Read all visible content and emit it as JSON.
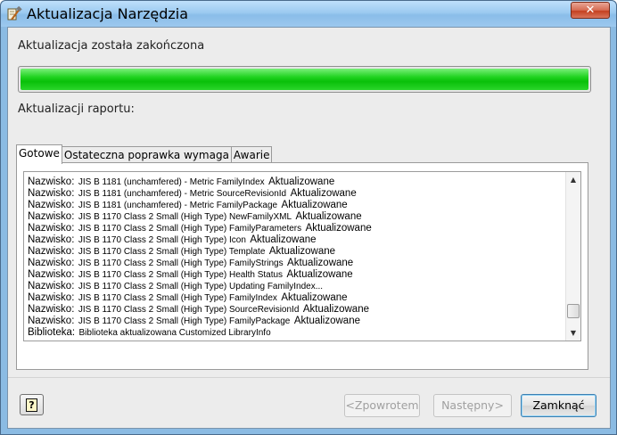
{
  "window": {
    "title": "Aktualizacja Narzędzia",
    "close_glyph": "✕",
    "app_icon": "tool-hammer-icon"
  },
  "status": {
    "message": "Aktualizacja została zakończona",
    "progress_percent": 100,
    "progress_color": "#0cc40c"
  },
  "report": {
    "label": "Aktualizacji raportu:"
  },
  "tabs": [
    {
      "label": "Gotowe",
      "active": true
    },
    {
      "label": "Ostateczna poprawka wymaga",
      "active": false
    },
    {
      "label": "Awarie",
      "active": false
    }
  ],
  "log_rows": [
    {
      "key": "Nazwisko:",
      "value": "JIS B 1181 (unchamfered) - Metric FamilyIndex",
      "status": "Aktualizowane"
    },
    {
      "key": "Nazwisko:",
      "value": "JIS B 1181 (unchamfered) - Metric SourceRevisionId",
      "status": "Aktualizowane"
    },
    {
      "key": "Nazwisko:",
      "value": "JIS B 1181 (unchamfered) - Metric FamilyPackage",
      "status": "Aktualizowane"
    },
    {
      "key": "Nazwisko:",
      "value": "JIS B 1170 Class 2 Small (High Type) NewFamilyXML",
      "status": "Aktualizowane"
    },
    {
      "key": "Nazwisko:",
      "value": "JIS B 1170 Class 2 Small (High Type) FamilyParameters",
      "status": "Aktualizowane"
    },
    {
      "key": "Nazwisko:",
      "value": "JIS B 1170 Class 2 Small (High Type) Icon",
      "status": "Aktualizowane"
    },
    {
      "key": "Nazwisko:",
      "value": "JIS B 1170 Class 2 Small (High Type) Template",
      "status": "Aktualizowane"
    },
    {
      "key": "Nazwisko:",
      "value": "JIS B 1170 Class 2 Small (High Type) FamilyStrings",
      "status": "Aktualizowane"
    },
    {
      "key": "Nazwisko:",
      "value": "JIS B 1170 Class 2 Small (High Type) Health Status",
      "status": "Aktualizowane"
    },
    {
      "key": "Nazwisko:",
      "value": "JIS B 1170 Class 2 Small (High Type) Updating FamilyIndex...",
      "status": ""
    },
    {
      "key": "Nazwisko:",
      "value": "JIS B 1170 Class 2 Small (High Type) FamilyIndex",
      "status": "Aktualizowane"
    },
    {
      "key": "Nazwisko:",
      "value": "JIS B 1170 Class 2 Small (High Type) SourceRevisionId",
      "status": "Aktualizowane"
    },
    {
      "key": "Nazwisko:",
      "value": "JIS B 1170 Class 2 Small (High Type) FamilyPackage",
      "status": "Aktualizowane"
    },
    {
      "key": "Biblioteka:",
      "value": "Biblioteka aktualizowana Customized LibraryInfo",
      "status": ""
    }
  ],
  "scrollbar": {
    "up_glyph": "▲",
    "down_glyph": "▼",
    "position_fraction": 0.92
  },
  "buttons": {
    "help_glyph": "?",
    "prev_label": "<Zpowrotem",
    "next_label": "Następny>",
    "close_label": "Zamknąć"
  }
}
